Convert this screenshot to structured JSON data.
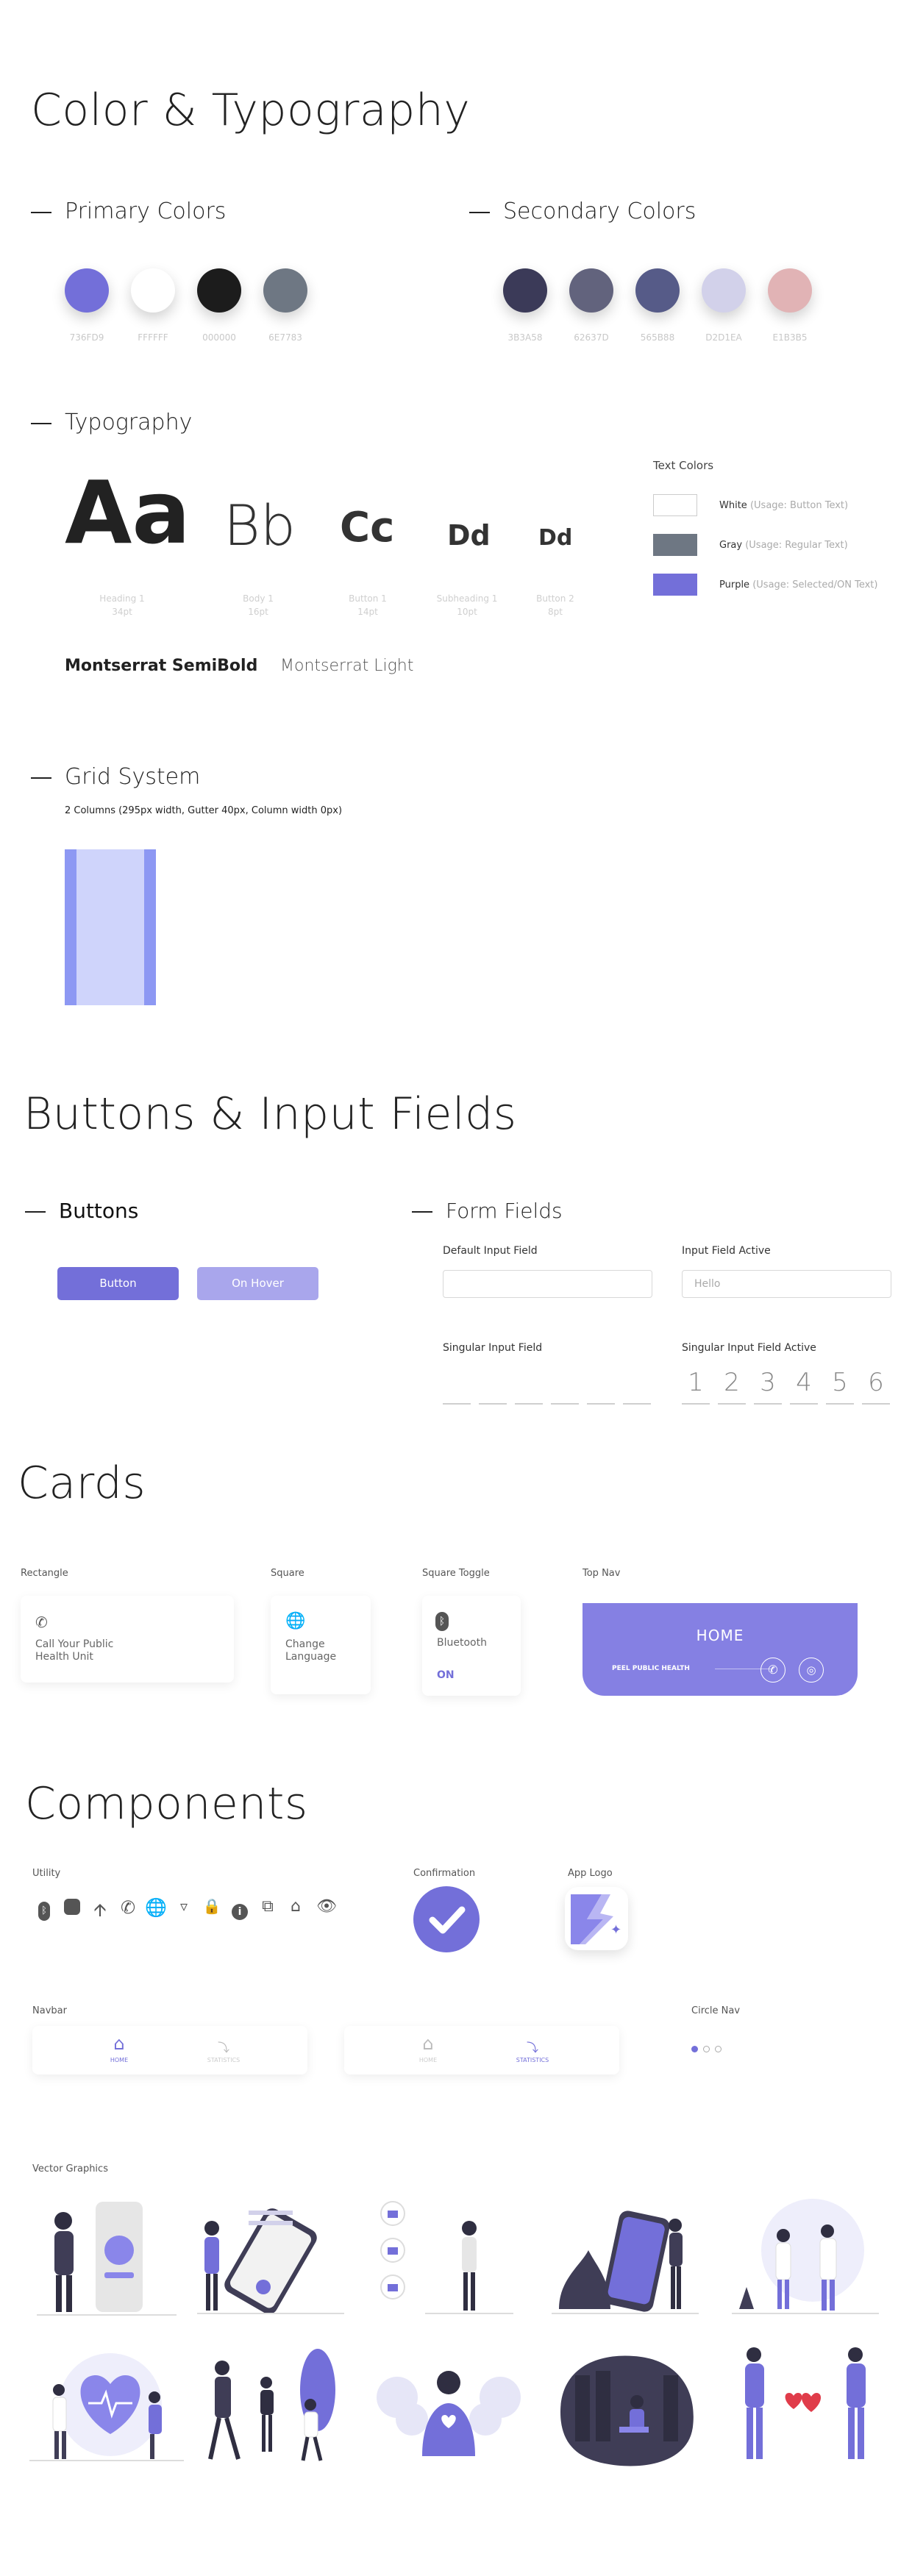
{
  "titles": {
    "color_typo": "Color & Typography",
    "buttons_inputs": "Buttons & Input Fields",
    "cards": "Cards",
    "components": "Components"
  },
  "sections": {
    "primary": "Primary Colors",
    "secondary": "Secondary Colors",
    "typography": "Typography",
    "grid": "Grid System",
    "buttons": "Buttons",
    "form": "Form Fields"
  },
  "primary_colors": [
    {
      "hex": "736FD9",
      "color": "#736FD9"
    },
    {
      "hex": "FFFFFF",
      "color": "#FFFFFF"
    },
    {
      "hex": "000000",
      "color": "#1c1c1c"
    },
    {
      "hex": "6E7783",
      "color": "#6E7783"
    }
  ],
  "secondary_colors": [
    {
      "hex": "3B3A58",
      "color": "#3B3A58"
    },
    {
      "hex": "62637D",
      "color": "#62637D"
    },
    {
      "hex": "565B88",
      "color": "#565B88"
    },
    {
      "hex": "D2D1EA",
      "color": "#D2D1EA"
    },
    {
      "hex": "E1B3B5",
      "color": "#E1B3B5"
    }
  ],
  "type_samples": [
    {
      "glyph": "Aa",
      "cap1": "Heading 1",
      "cap2": "34pt"
    },
    {
      "glyph": "Bb",
      "cap1": "Body 1",
      "cap2": "16pt"
    },
    {
      "glyph": "Cc",
      "cap1": "Button 1",
      "cap2": "14pt"
    },
    {
      "glyph": "Dd",
      "cap1": "Subheading 1",
      "cap2": "10pt"
    },
    {
      "glyph": "Dd",
      "cap1": "Button 2",
      "cap2": "8pt"
    }
  ],
  "fonts": {
    "semibold": "Montserrat SemiBold",
    "light": "Montserrat Light"
  },
  "text_colors": {
    "title": "Text Colors",
    "items": [
      {
        "name": "White",
        "usage": "(Usage: Button Text)",
        "color": "#ffffff"
      },
      {
        "name": "Gray",
        "usage": "(Usage: Regular Text)",
        "color": "#6E7783"
      },
      {
        "name": "Purple",
        "usage": "(Usage: Selected/ON Text)",
        "color": "#736FD9"
      }
    ]
  },
  "grid": {
    "desc": "2 Columns (295px width, Gutter 40px, Column width 0px)"
  },
  "buttons": {
    "primary": "Button",
    "hover": "On Hover"
  },
  "form": {
    "default_label": "Default Input Field",
    "active_label": "Input Field Active",
    "active_value": "Hello",
    "singular_label": "Singular Input Field",
    "singular_active_label": "Singular Input Field Active",
    "digits": [
      "1",
      "2",
      "3",
      "4",
      "5",
      "6"
    ]
  },
  "cards": {
    "rect_label": "Rectangle",
    "rect_text1": "Call Your Public",
    "rect_text2": "Health Unit",
    "square_label": "Square",
    "square_text1": "Change",
    "square_text2": "Language",
    "toggle_label": "Square Toggle",
    "toggle_text": "Bluetooth",
    "toggle_state": "ON",
    "topnav_label": "Top Nav",
    "topnav_title": "HOME",
    "topnav_sub": "PEEL PUBLIC HEALTH"
  },
  "components": {
    "utility": "Utility",
    "confirmation": "Confirmation",
    "app_logo": "App Logo",
    "navbar": "Navbar",
    "circle_nav": "Circle Nav",
    "vector": "Vector Graphics",
    "nav_home": "HOME",
    "nav_stats": "STATISTICS",
    "utility_icons": [
      "bluetooth-icon",
      "chat-icon",
      "arrow-up-icon",
      "phone-icon",
      "globe-icon",
      "filter-icon",
      "lock-icon",
      "info-icon",
      "share-icon",
      "home-icon",
      "eye-icon"
    ]
  },
  "accent": "#736FD9"
}
